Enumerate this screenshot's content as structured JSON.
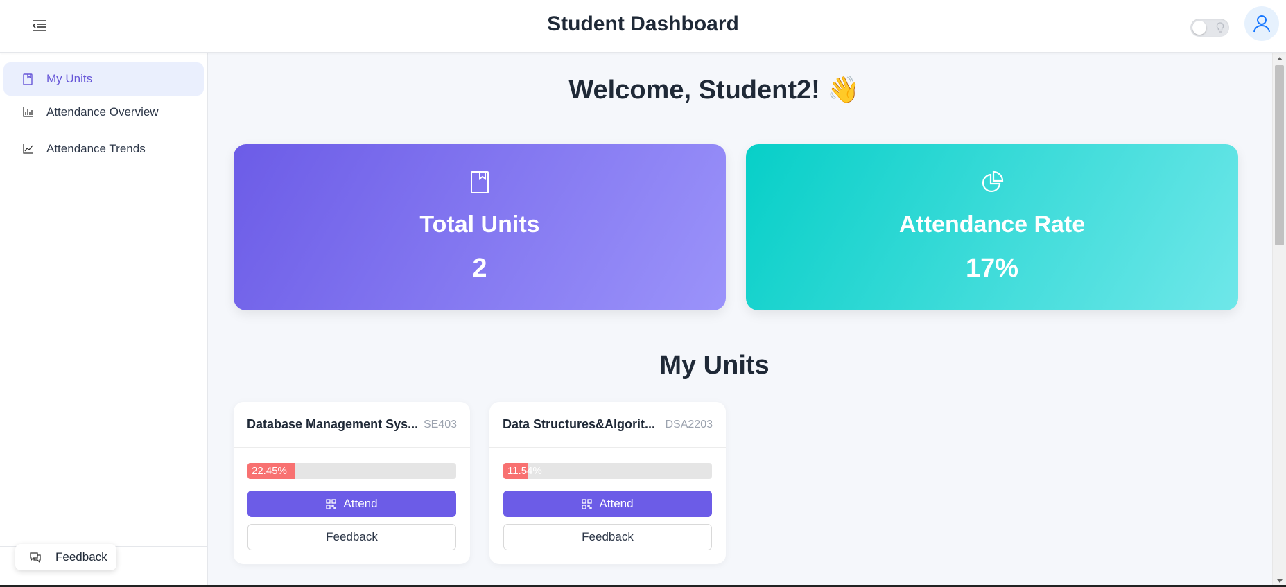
{
  "header": {
    "title": "Student Dashboard"
  },
  "sidebar": {
    "items": [
      {
        "label": "My Units",
        "icon": "book-icon",
        "active": true
      },
      {
        "label": "Attendance Overview",
        "icon": "bar-chart-icon",
        "active": false
      },
      {
        "label": "Attendance Trends",
        "icon": "line-chart-icon",
        "active": false
      }
    ],
    "feedback_label": "Feedback"
  },
  "main": {
    "welcome": "Welcome, Student2! 👋",
    "stats": [
      {
        "label": "Total Units",
        "value": "2",
        "icon": "book-icon",
        "color_from": "#6c5ce7",
        "color_to": "#9b93fa"
      },
      {
        "label": "Attendance Rate",
        "value": "17%",
        "icon": "pie-chart-icon",
        "color_from": "#07cfc8",
        "color_to": "#6fe7e9"
      }
    ],
    "section_title": "My Units",
    "units": [
      {
        "name": "Database Management Sys...",
        "code": "SE403",
        "progress_text": "22.45%",
        "progress": 0.2245,
        "attend_label": "Attend",
        "feedback_label": "Feedback"
      },
      {
        "name": "Data Structures&Algorit...",
        "code": "DSA2203",
        "progress_text": "11.54%",
        "progress": 0.1154,
        "attend_label": "Attend",
        "feedback_label": "Feedback"
      }
    ]
  },
  "colors": {
    "accent": "#6c5ce7",
    "progress_fill": "#f87171",
    "active_bg": "#eaeffd",
    "active_text": "#6757d8"
  }
}
